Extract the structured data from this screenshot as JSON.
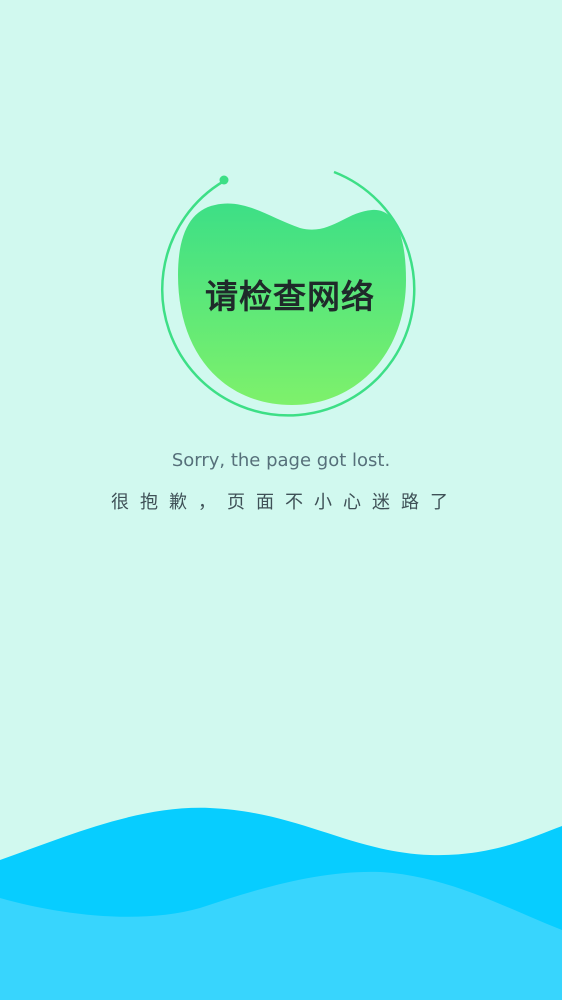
{
  "error": {
    "title": "请检查网络",
    "message_en": "Sorry, the page got lost.",
    "message_cn": "很抱歉，页面不小心迷路了"
  },
  "colors": {
    "background": "#d1f9ef",
    "blob_top": "#3ddf86",
    "blob_bottom": "#7ef16b",
    "ring": "#3ddf86",
    "wave_back": "#07cdff",
    "wave_front": "#38d5fd"
  },
  "icons": {
    "emblem": "network-error-blob-icon"
  }
}
